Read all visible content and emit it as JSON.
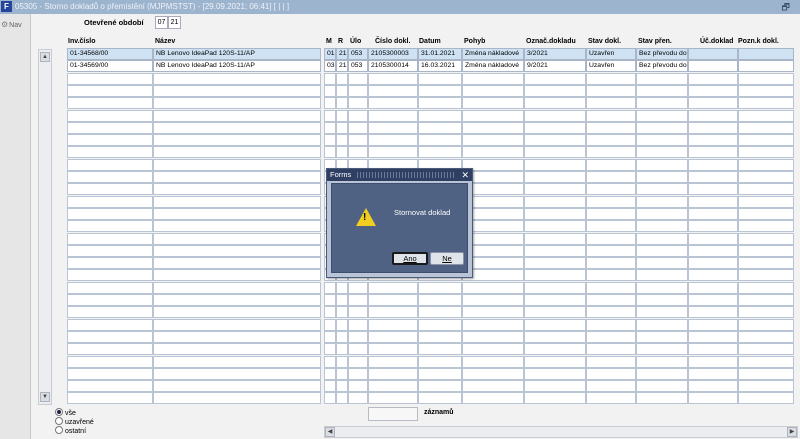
{
  "window": {
    "title": "05305 - Storno dokladů o přemístění (MJPMSTST) - [29.09.2021; 06:41] [ | | ]",
    "app_icon": "F",
    "restore_glyph": "🗗"
  },
  "nav": {
    "label": "Nav"
  },
  "period": {
    "label": "Otevřené období",
    "month": "07",
    "year": "21"
  },
  "columns": {
    "inv": "Inv.číslo",
    "name": "Název",
    "m": "M",
    "r": "R",
    "ulo": "Úlo",
    "doc": "Číslo dokl.",
    "date": "Datum",
    "move": "Pohyb",
    "mark": "Označ.dokladu",
    "state": "Stav dokl.",
    "transfer": "Stav přen.",
    "acc": "Úč.doklad",
    "note": "Pozn.k dokl."
  },
  "rows": [
    {
      "inv": "01-34568/00",
      "name": "NB Lenovo IdeaPad 120S-11/AP",
      "m": "01",
      "r": "21",
      "ulo": "053",
      "doc": "2105300003",
      "date": "31.01.2021",
      "move": "Změna nákladové",
      "mark": "3/2021",
      "state": "Uzavřen",
      "transfer": "Bez převodu do",
      "acc": "",
      "note": ""
    },
    {
      "inv": "01-34569/00",
      "name": "NB Lenovo IdeaPad 120S-11/AP",
      "m": "03",
      "r": "21",
      "ulo": "053",
      "doc": "2105300014",
      "date": "16.03.2021",
      "move": "Změna nákladové",
      "mark": "9/2021",
      "state": "Uzavřen",
      "transfer": "Bez převodu do",
      "acc": "",
      "note": ""
    }
  ],
  "filter": {
    "options": [
      "vše",
      "uzavřené",
      "ostatní"
    ],
    "selected": "vše"
  },
  "records": {
    "label": "záznamů",
    "count": ""
  },
  "dialog": {
    "title": "Forms",
    "icon": "warning-icon",
    "message": "Stornovat doklad",
    "yes_label": "Ano",
    "no_label": "Ne"
  }
}
